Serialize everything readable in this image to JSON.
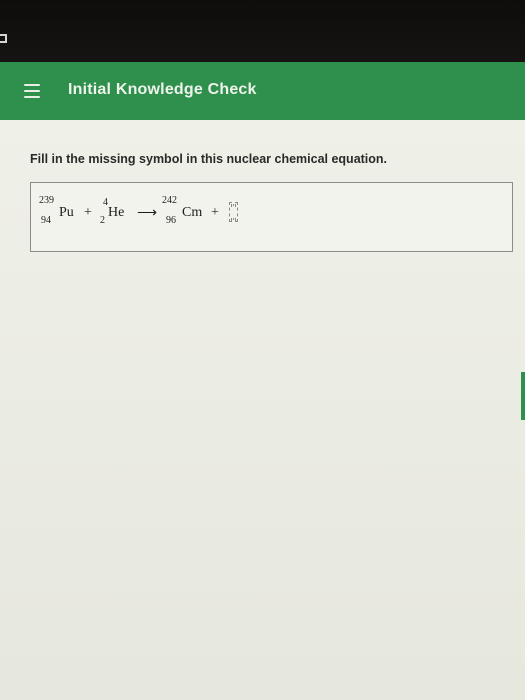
{
  "header": {
    "title": "Initial Knowledge Check",
    "menu_icon": "hamburger-menu-icon"
  },
  "question": {
    "prompt": "Fill in the missing symbol in this nuclear chemical equation."
  },
  "equation": {
    "reactant1": {
      "mass": "239",
      "atomic": "94",
      "symbol": "Pu"
    },
    "plus1": "+",
    "reactant2": {
      "mass": "4",
      "atomic": "2",
      "symbol": "He"
    },
    "arrow": "⟶",
    "product1": {
      "mass": "242",
      "atomic": "96",
      "symbol": "Cm"
    },
    "plus2": "+",
    "missing_symbol": ""
  },
  "colors": {
    "header_bg": "#2f8f4d",
    "header_text": "#eef3ec",
    "frame_bg": "#0e0d0c",
    "content_bg": "#eff0e8"
  }
}
